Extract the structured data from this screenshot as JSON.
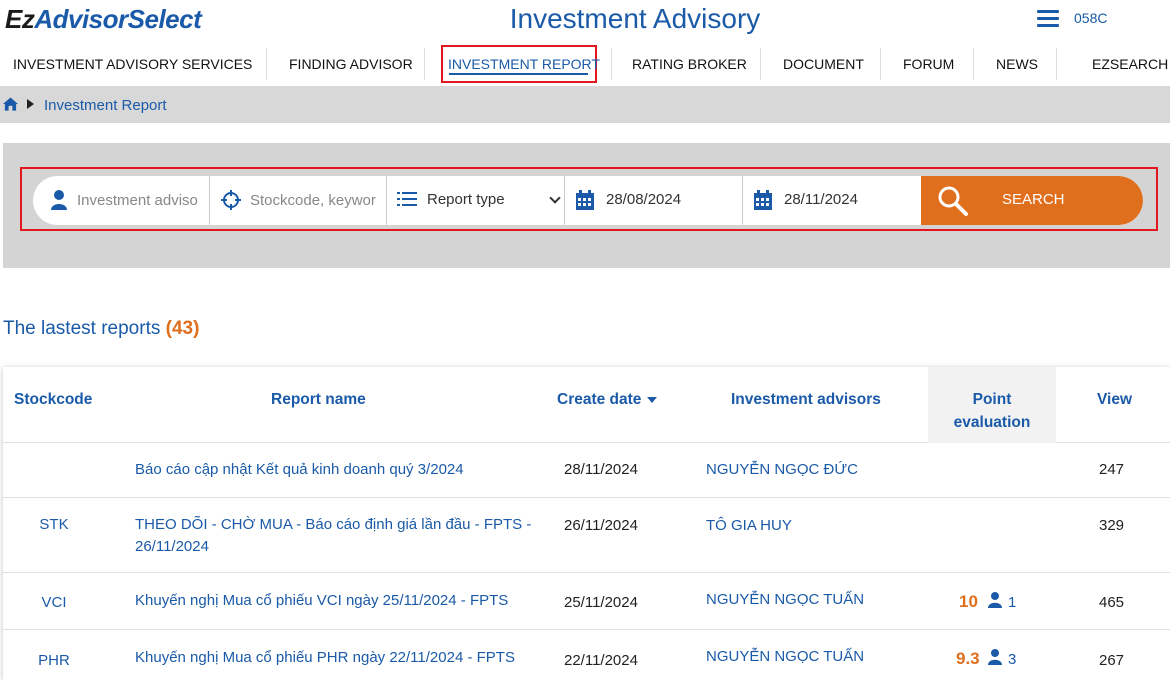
{
  "header": {
    "logo_ez": "Ez",
    "logo_brand": "AdvisorSelect",
    "title": "Investment Advisory",
    "user_code": "058C"
  },
  "nav": {
    "items": [
      {
        "label": "INVESTMENT ADVISORY SERVICES"
      },
      {
        "label": "FINDING ADVISOR"
      },
      {
        "label": "INVESTMENT REPORT"
      },
      {
        "label": "RATING BROKER"
      },
      {
        "label": "DOCUMENT"
      },
      {
        "label": "FORUM"
      },
      {
        "label": "NEWS"
      },
      {
        "label": "EZSEARCH"
      }
    ],
    "active_index": 2
  },
  "breadcrumb": {
    "current": "Investment Report"
  },
  "search": {
    "advisor_placeholder": "Investment adviso",
    "keyword_placeholder": "Stockcode, keywor",
    "report_type": "Report type",
    "date_from": "28/08/2024",
    "date_to": "28/11/2024",
    "button_label": "SEARCH"
  },
  "reports": {
    "title": "The lastest reports",
    "count": "(43)",
    "columns": {
      "stockcode": "Stockcode",
      "report_name": "Report name",
      "create_date": "Create date",
      "advisors": "Investment advisors",
      "point_line1": "Point",
      "point_line2": "evaluation",
      "view": "View"
    },
    "rows": [
      {
        "stockcode": "",
        "name": "Báo cáo cập nhật Kết quả kinh doanh quý 3/2024",
        "date": "28/11/2024",
        "advisor": "NGUYỄN NGỌC ĐỨC",
        "point": "",
        "raters": "",
        "view": "247"
      },
      {
        "stockcode": "STK",
        "name": "THEO DÕI - CHỜ MUA - Báo cáo định giá lần đầu - FPTS - 26/11/2024",
        "date": "26/11/2024",
        "advisor": "TÔ GIA HUY",
        "point": "",
        "raters": "",
        "view": "329"
      },
      {
        "stockcode": "VCI",
        "name": "Khuyến nghị Mua cổ phiếu VCI ngày 25/11/2024 - FPTS",
        "date": "25/11/2024",
        "advisor": "NGUYỄN NGỌC TUẤN",
        "point": "10",
        "raters": "1",
        "view": "465"
      },
      {
        "stockcode": "PHR",
        "name": "Khuyến nghị Mua cổ phiếu PHR ngày 22/11/2024 - FPTS",
        "date": "22/11/2024",
        "advisor": "NGUYỄN NGỌC TUẤN",
        "point": "9.3",
        "raters": "3",
        "view": "267"
      }
    ]
  },
  "colors": {
    "brand_blue": "#1a5aa8",
    "accent_orange": "#e06f1d",
    "highlight_red": "#e3151f"
  }
}
